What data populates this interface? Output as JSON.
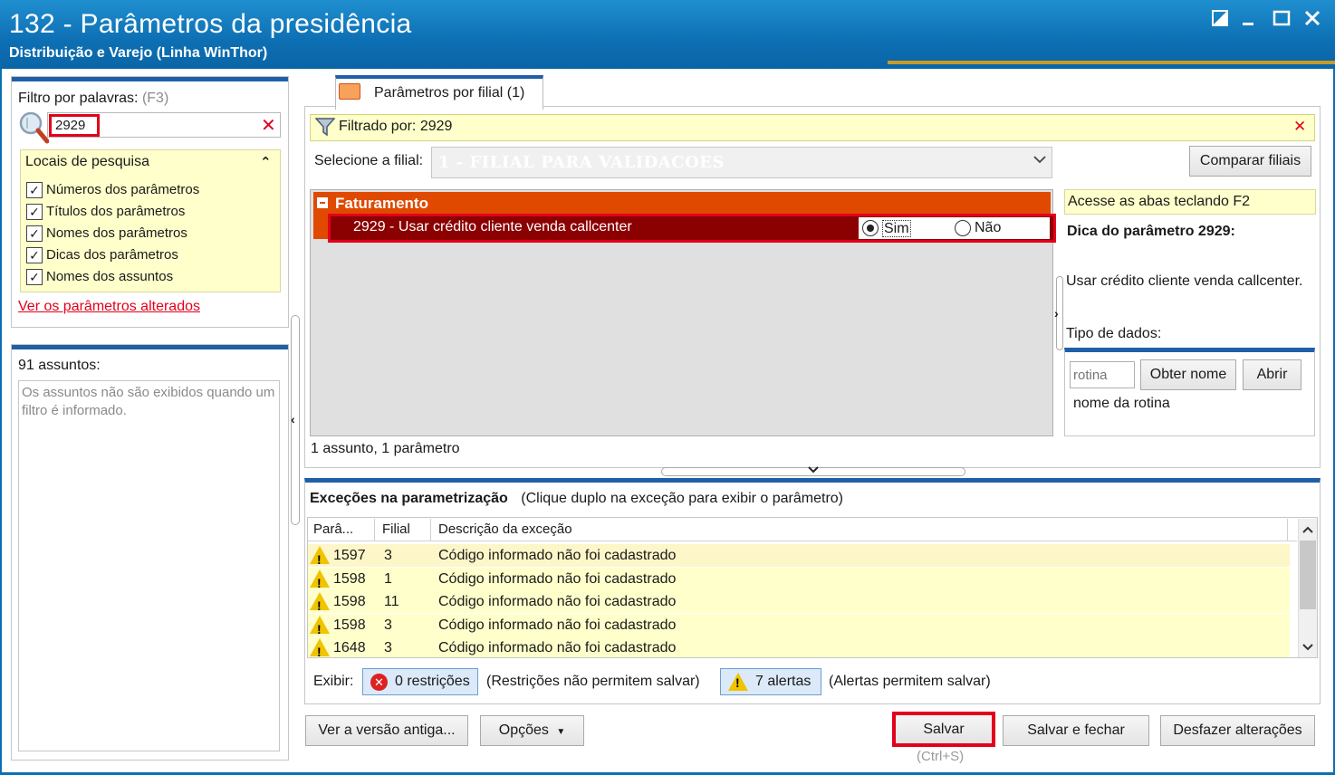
{
  "window": {
    "title": "132 - Parâmetros da presidência",
    "subtitle": "Distribuição e Varejo (Linha WinThor)"
  },
  "left": {
    "filter_label": "Filtro por palavras:",
    "filter_shortcut": "(F3)",
    "filter_value": "2929",
    "locais_title": "Locais de pesquisa",
    "checkboxes": [
      {
        "label": "Números dos parâmetros",
        "checked": true
      },
      {
        "label": "Títulos dos parâmetros",
        "checked": true
      },
      {
        "label": "Nomes dos parâmetros",
        "checked": true
      },
      {
        "label": "Dicas dos parâmetros",
        "checked": true
      },
      {
        "label": "Nomes dos assuntos",
        "checked": true
      }
    ],
    "changed_link": "Ver os parâmetros alterados",
    "assuntos_count": "91 assuntos:",
    "assuntos_note": "Os assuntos não são exibidos quando um filtro é informado."
  },
  "main": {
    "tab_label": "Parâmetros por filial",
    "tab_count": "(1)",
    "filtered_by": "Filtrado por: 2929",
    "select_filial_label": "Selecione a filial:",
    "filial_value": "1 - FILIAL PARA VALIDACOES",
    "compare_button": "Comparar filiais",
    "group_name": "Faturamento",
    "param_label": "2929 - Usar crédito cliente venda callcenter",
    "radio_yes": "Sim",
    "radio_no": "Não",
    "status": "1 assunto, 1 parâmetro"
  },
  "tip": {
    "hint": "Acesse as abas teclando F2",
    "title": "Dica do parâmetro 2929:",
    "text": "Usar crédito cliente venda callcenter.",
    "data_type_label": "Tipo de dados:",
    "rotina_placeholder": "rotina",
    "get_name_button": "Obter nome",
    "open_button": "Abrir",
    "rotina_name": "nome da rotina"
  },
  "exceptions": {
    "title": "Exceções na parametrização",
    "subtitle": "(Clique duplo na exceção para exibir o parâmetro)",
    "columns": [
      "Parâ...",
      "Filial",
      "Descrição da exceção"
    ],
    "rows": [
      {
        "param": "1597",
        "filial": "3",
        "desc": "Código informado não foi cadastrado"
      },
      {
        "param": "1598",
        "filial": "1",
        "desc": "Código informado não foi cadastrado"
      },
      {
        "param": "1598",
        "filial": "11",
        "desc": "Código informado não foi cadastrado"
      },
      {
        "param": "1598",
        "filial": "3",
        "desc": "Código informado não foi cadastrado"
      },
      {
        "param": "1648",
        "filial": "3",
        "desc": "Código informado não foi cadastrado"
      }
    ],
    "show_label": "Exibir:",
    "restrictions_button": "0 restrições",
    "restrictions_note": "(Restrições não permitem salvar)",
    "alerts_button": "7 alertas",
    "alerts_note": "(Alertas permitem salvar)"
  },
  "footer": {
    "old_version": "Ver a versão antiga...",
    "options": "Opções",
    "save": "Salvar",
    "save_shortcut": "(Ctrl+S)",
    "save_close": "Salvar e fechar",
    "undo": "Desfazer alterações"
  },
  "colors": {
    "title_bar": "#0d6fb3",
    "accent_red": "#e3001b",
    "group_orange": "#e04a00",
    "selected_row": "#8b0000",
    "highlight_yellow": "#ffffcc"
  }
}
